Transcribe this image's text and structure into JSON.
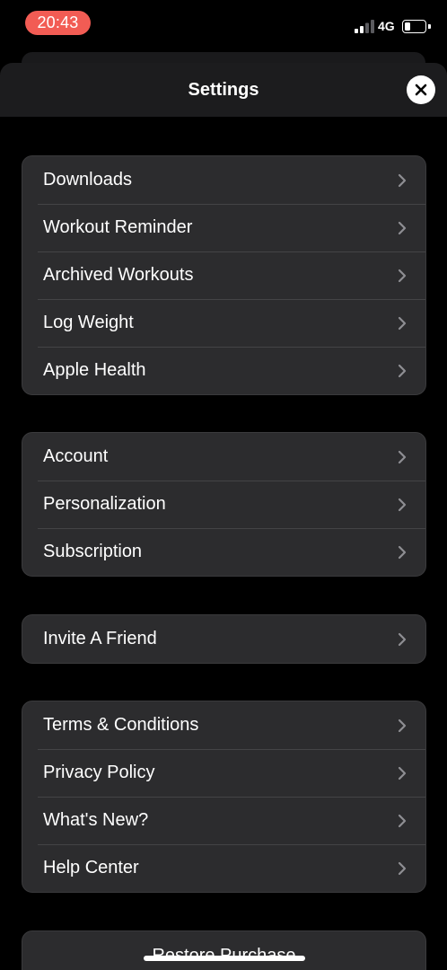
{
  "status_bar": {
    "time": "20:43",
    "network": "4G",
    "battery_level": 0.3,
    "time_pill_color": "#f25c54"
  },
  "sheet": {
    "title": "Settings"
  },
  "groups": [
    {
      "items": [
        "Downloads",
        "Workout Reminder",
        "Archived Workouts",
        "Log Weight",
        "Apple Health"
      ]
    },
    {
      "items": [
        "Account",
        "Personalization",
        "Subscription"
      ]
    },
    {
      "items": [
        "Invite A Friend"
      ]
    },
    {
      "items": [
        "Terms & Conditions",
        "Privacy Policy",
        "What's New?",
        "Help Center"
      ]
    }
  ],
  "restore": {
    "label": "Restore Purchase"
  },
  "icons": {
    "close": "close-icon",
    "chevron": "chevron-right-icon",
    "signal": "cellular-signal-icon",
    "battery": "battery-icon"
  },
  "colors": {
    "background": "#000000",
    "card": "#2c2c2e",
    "header": "#1c1c1e",
    "separator": "#444446",
    "chevron": "#8e8e93"
  }
}
